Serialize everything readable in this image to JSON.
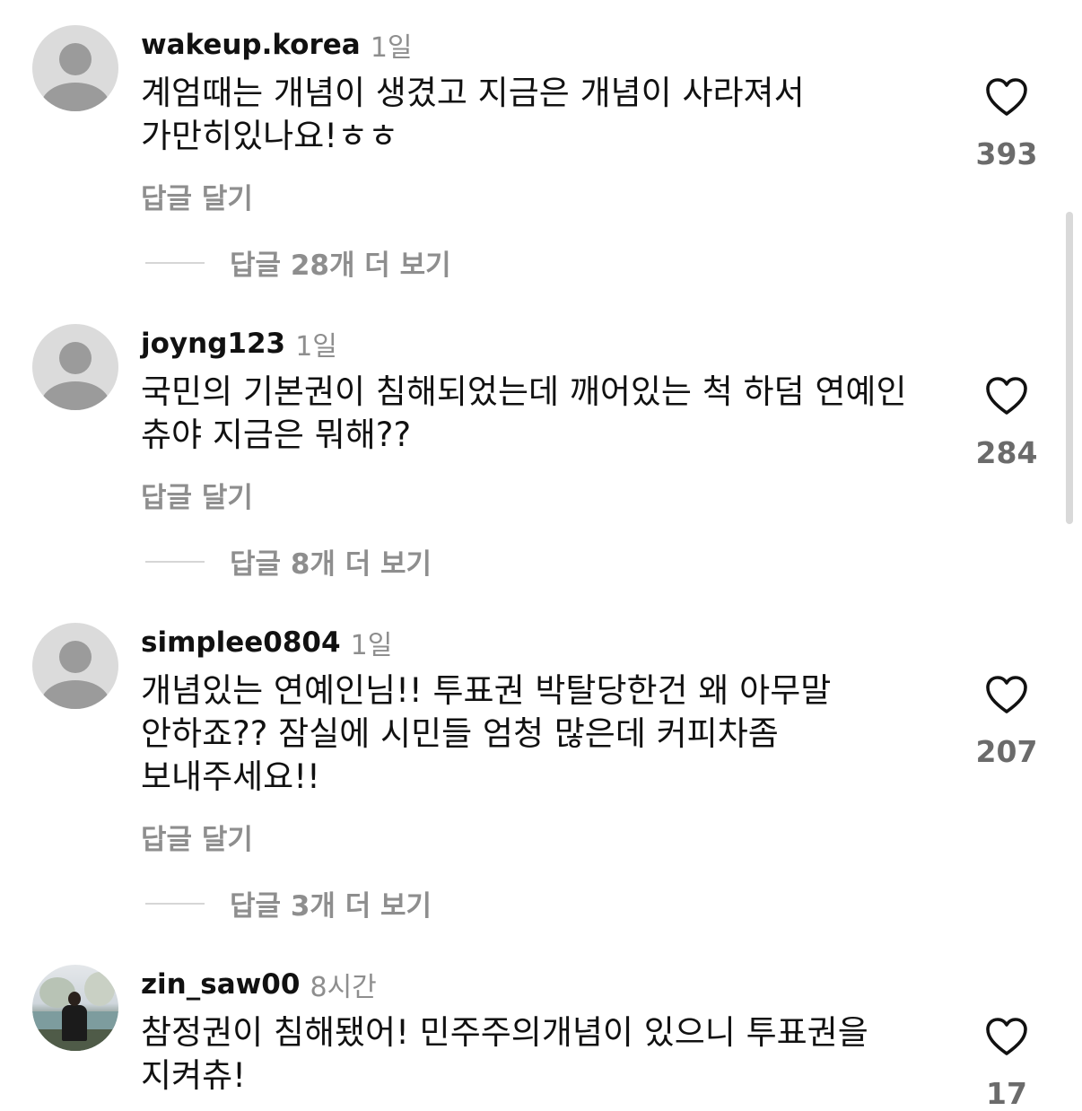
{
  "comments": [
    {
      "username": "wakeup.korea",
      "time": "1일",
      "text": "계엄때는 개념이 생겼고 지금은 개념이 사라져서 가만히있나요!ㅎㅎ",
      "reply_label": "답글 달기",
      "view_replies": "답글 28개 더 보기",
      "likes": "393",
      "avatar": "default-avatar"
    },
    {
      "username": "joyng123",
      "time": "1일",
      "text": "국민의 기본권이 침해되었는데 깨어있는 척 하덤 연예인 츄야 지금은 뭐해??",
      "reply_label": "답글 달기",
      "view_replies": "답글 8개 더 보기",
      "likes": "284",
      "avatar": "default-avatar"
    },
    {
      "username": "simplee0804",
      "time": "1일",
      "text": "개념있는 연예인님!! 투표권 박탈당한건 왜 아무말 안하죠?? 잠실에 시민들 엄청 많은데 커피차좀 보내주세요!!",
      "reply_label": "답글 달기",
      "view_replies": "답글 3개 더 보기",
      "likes": "207",
      "avatar": "default-avatar"
    },
    {
      "username": "zin_saw00",
      "time": "8시간",
      "text": "참정권이 침해됐어! 민주주의개념이 있으니 투표권을 지켜츄!",
      "likes": "17",
      "avatar": "profile-photo"
    }
  ],
  "icons": {
    "like": "heart-outline-icon",
    "avatar_default": "default-avatar-icon"
  },
  "colors": {
    "username": "#111111",
    "secondary_text": "#8e8e8e",
    "like_count": "#6b6b6b",
    "divider": "#d6d6d6",
    "avatar_bg": "#dbdbdb",
    "avatar_fg": "#9b9b9b"
  }
}
